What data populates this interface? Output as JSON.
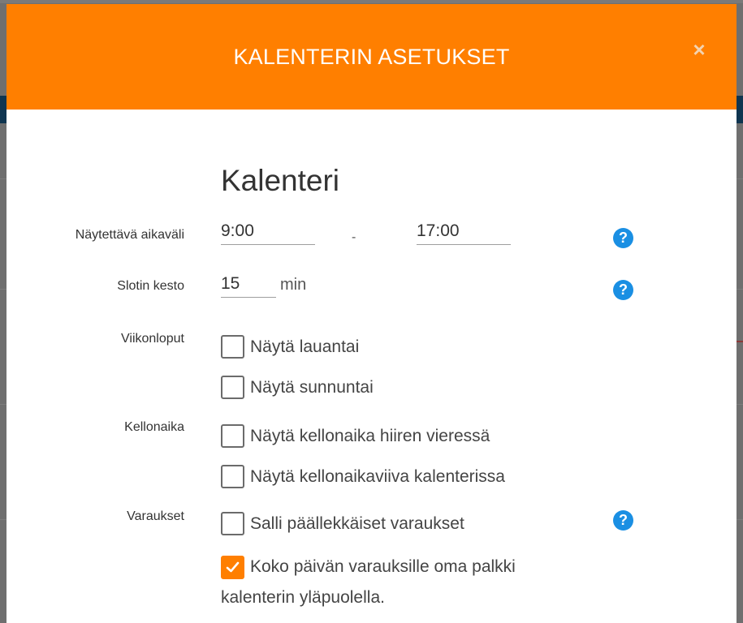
{
  "modal": {
    "title": "KALENTERIN ASETUKSET",
    "close_glyph": "×"
  },
  "section": {
    "title": "Kalenteri"
  },
  "time_range": {
    "label": "Näytettävä aikaväli",
    "start": "9:00",
    "separator": "-",
    "end": "17:00"
  },
  "slot": {
    "label": "Slotin kesto",
    "value": "15",
    "unit": "min"
  },
  "weekends": {
    "label": "Viikonloput",
    "options": [
      {
        "label": "Näytä lauantai",
        "checked": false
      },
      {
        "label": "Näytä sunnuntai",
        "checked": false
      }
    ]
  },
  "clock": {
    "label": "Kellonaika",
    "options": [
      {
        "label": "Näytä kellonaika hiiren vieressä",
        "checked": false
      },
      {
        "label": "Näytä kellonaikaviiva kalenterissa",
        "checked": false
      }
    ]
  },
  "bookings": {
    "label": "Varaukset",
    "options": [
      {
        "label": "Salli päällekkäiset varaukset",
        "checked": false
      },
      {
        "label": "Koko päivän varauksille oma palkki kalenterin yläpuolella.",
        "checked": true
      }
    ]
  },
  "help_glyph": "?",
  "colors": {
    "accent": "#ff7f00",
    "help": "#1a8fe3"
  }
}
